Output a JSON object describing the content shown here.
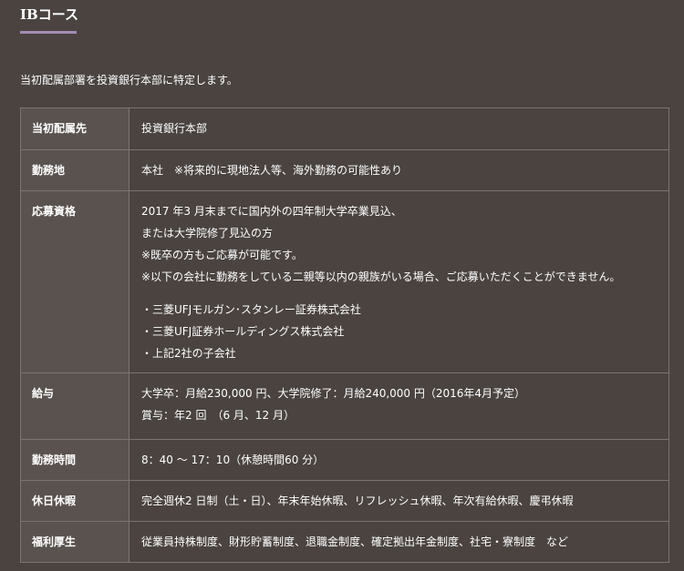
{
  "section": {
    "title": "IBコース",
    "intro": "当初配属部署を投資銀行本部に特定します。"
  },
  "rows": [
    {
      "label": "当初配属先",
      "lines": [
        "投資銀行本部"
      ]
    },
    {
      "label": "勤務地",
      "lines": [
        "本社　※将来的に現地法人等、海外勤務の可能性あり"
      ]
    },
    {
      "label": "応募資格",
      "lines": [
        "2017 年3 月末までに国内外の四年制大学卒業見込、",
        "または大学院修了見込の方",
        "※既卒の方もご応募が可能です。",
        "※以下の会社に勤務をしている二親等以内の親族がいる場合、ご応募いただくことができません。"
      ],
      "companies": [
        "・三菱UFJモルガン･スタンレー証券株式会社",
        "・三菱UFJ証券ホールディングス株式会社",
        "・上記2社の子会社"
      ]
    },
    {
      "label": "給与",
      "lines": [
        "大学卒：月給230,000 円、大学院修了：月給240,000 円（2016年4月予定）",
        "賞与：年2 回　（6 月、12 月）"
      ]
    },
    {
      "label": "勤務時間",
      "lines": [
        "8：40 〜 17：10（休憩時間60 分）"
      ]
    },
    {
      "label": "休日休暇",
      "lines": [
        "完全週休2 日制（土・日）、年末年始休暇、リフレッシュ休暇、年次有給休暇、慶弔休暇"
      ]
    },
    {
      "label": "福利厚生",
      "lines": [
        "従業員持株制度、財形貯蓄制度、退職金制度、確定拠出年金制度、社宅・寮制度　など"
      ]
    }
  ]
}
